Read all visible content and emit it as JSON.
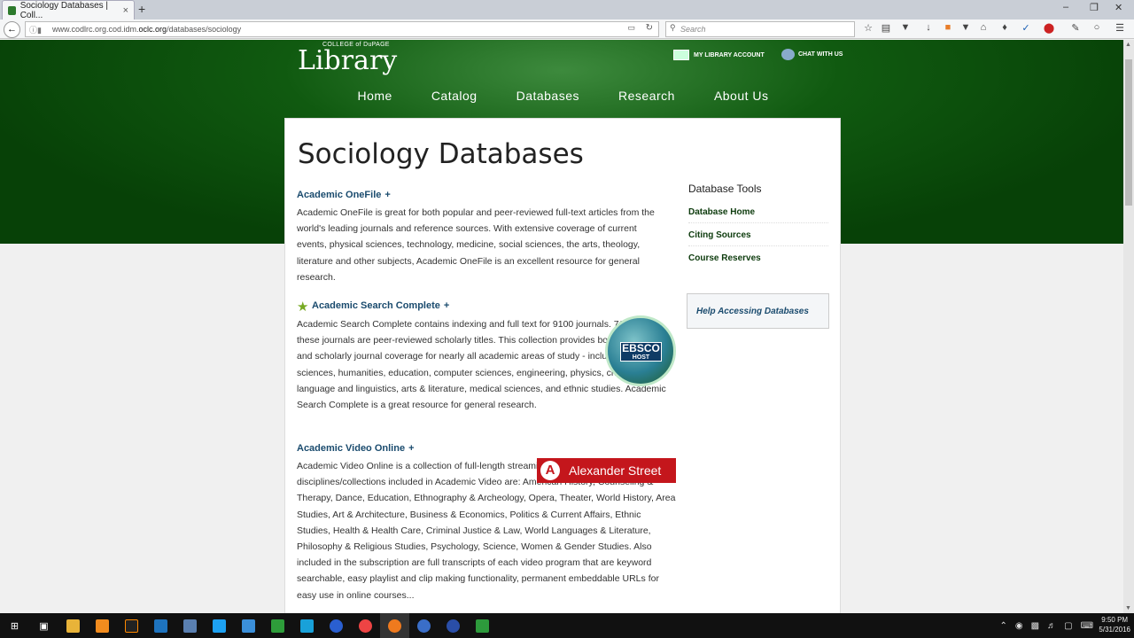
{
  "browser": {
    "tab_title": "Sociology Databases | Coll...",
    "url_prefix": "www.codlrc.org.cod.idm.",
    "url_domain": "oclc.org",
    "url_path": "/databases/sociology",
    "search_placeholder": "Search",
    "new_tab": "+",
    "tab_close": "×"
  },
  "header": {
    "logo_small": "COLLEGE of DuPAGE",
    "logo_big": "Library",
    "account_label": "MY LIBRARY ACCOUNT",
    "chat_label": "CHAT WITH US"
  },
  "nav": {
    "items": [
      {
        "label": "Home"
      },
      {
        "label": "Catalog"
      },
      {
        "label": "Databases"
      },
      {
        "label": "Research"
      },
      {
        "label": "About Us"
      }
    ]
  },
  "main": {
    "title": "Sociology Databases",
    "databases": [
      {
        "title": "Academic OneFile",
        "plus": "+",
        "description": "Academic OneFile is great for both popular and peer-reviewed full-text articles from the world's leading journals and reference sources. With extensive coverage of current events, physical sciences, technology, medicine, social sciences, the arts, theology, literature and other subjects, Academic OneFile is an excellent resource for general research."
      },
      {
        "title": "Academic Search Complete",
        "plus": "+",
        "description": "Academic Search Complete contains indexing and full text for 9100 journals. 7100 of these journals are peer-reviewed scholarly titles. This collection provides both popular and scholarly journal coverage for nearly all academic areas of study - including social sciences, humanities, education, computer sciences, engineering, physics, chemistry, language and linguistics, arts & literature, medical sciences, and ethnic studies. Academic Search Complete is a great resource for general research."
      },
      {
        "title": "Academic Video Online",
        "plus": "+",
        "description": "Academic Video Online is a collection of full-length streaming videos. The disciplines/collections included in Academic Video are: American History, Counseling & Therapy, Dance, Education, Ethnography & Archeology, Opera, Theater, World History, Area Studies, Art & Architecture, Business & Economics, Politics & Current Affairs, Ethnic Studies, Health & Health Care, Criminal Justice & Law, World Languages & Literature, Philosophy & Religious Studies, Psychology, Science, Women & Gender Studies. Also included in the subscription are full transcripts of each video program that are keyword searchable, easy playlist and clip making functionality, permanent embeddable URLs for easy use in online courses..."
      }
    ],
    "ebsco_label": "EBSCO",
    "ebsco_sub": "HOST",
    "alex_label": "Alexander Street",
    "alex_mark": "A"
  },
  "tools": {
    "heading": "Database Tools",
    "links": [
      {
        "label": "Database Home"
      },
      {
        "label": "Citing Sources"
      },
      {
        "label": "Course Reserves"
      }
    ],
    "help_label": "Help Accessing Databases"
  },
  "taskbar": {
    "time": "9:50 PM",
    "date": "5/31/2016"
  },
  "colors": {
    "brand_green": "#0b4a0b",
    "link_blue": "#1a4b6e",
    "alex_red": "#c4161c"
  }
}
